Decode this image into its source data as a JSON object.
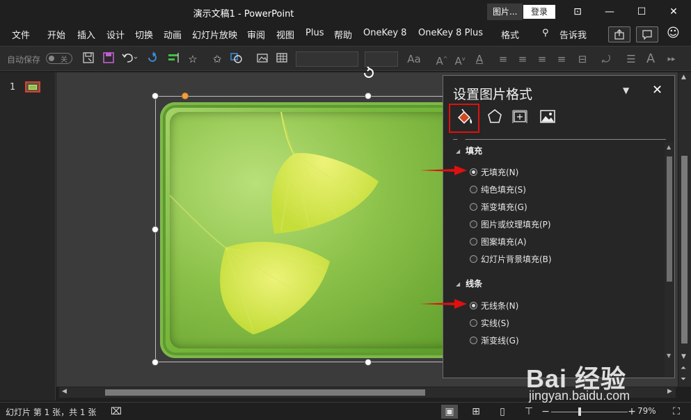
{
  "window": {
    "title": "演示文稿1  -  PowerPoint",
    "context_tab": "图片...",
    "login": "登录",
    "controls": {
      "ribbon_display": "⊡",
      "minimize": "—",
      "maximize": "☐",
      "close": "✕"
    }
  },
  "menu": {
    "items": [
      "文件",
      "开始",
      "插入",
      "设计",
      "切换",
      "动画",
      "幻灯片放映",
      "审阅",
      "视图",
      "Plus",
      "帮助",
      "OneKey 8",
      "OneKey 8 Plus",
      "格式"
    ],
    "tell_me": "告诉我",
    "search_icon": "⚲",
    "smiley_icon": "☺"
  },
  "toolbar": {
    "autosave_label": "自动保存",
    "autosave_state": "关",
    "font_size_label": "Aa",
    "icons": [
      "save-as-icon",
      "save-icon",
      "undo-icon",
      "redo-icon",
      "align-icon",
      "star-icon",
      "star-outline-icon",
      "shapes-icon",
      "picture-icon",
      "table-icon"
    ]
  },
  "thumbnails": {
    "slide_number": "1"
  },
  "format_pane": {
    "title": "设置图片格式",
    "dropdown_icon": "▼",
    "close_icon": "✕",
    "tabs": [
      "fill-line-tab",
      "effects-tab",
      "size-properties-tab",
      "picture-tab"
    ],
    "fill_section": {
      "label": "填充",
      "options": [
        {
          "label": "无填充(N)",
          "selected": true
        },
        {
          "label": "纯色填充(S)",
          "selected": false
        },
        {
          "label": "渐变填充(G)",
          "selected": false
        },
        {
          "label": "图片或纹理填充(P)",
          "selected": false
        },
        {
          "label": "图案填充(A)",
          "selected": false
        },
        {
          "label": "幻灯片背景填充(B)",
          "selected": false
        }
      ]
    },
    "line_section": {
      "label": "线条",
      "options": [
        {
          "label": "无线条(N)",
          "selected": true
        },
        {
          "label": "实线(S)",
          "selected": false
        },
        {
          "label": "渐变线(G)",
          "selected": false
        }
      ]
    },
    "accent_red": "#e01010"
  },
  "status": {
    "slide_info": "幻灯片 第 1 张，共 1 张",
    "zoom": "79%"
  },
  "watermark": {
    "line1": "Bai 经验",
    "line2": "jingyan.baidu.com"
  }
}
